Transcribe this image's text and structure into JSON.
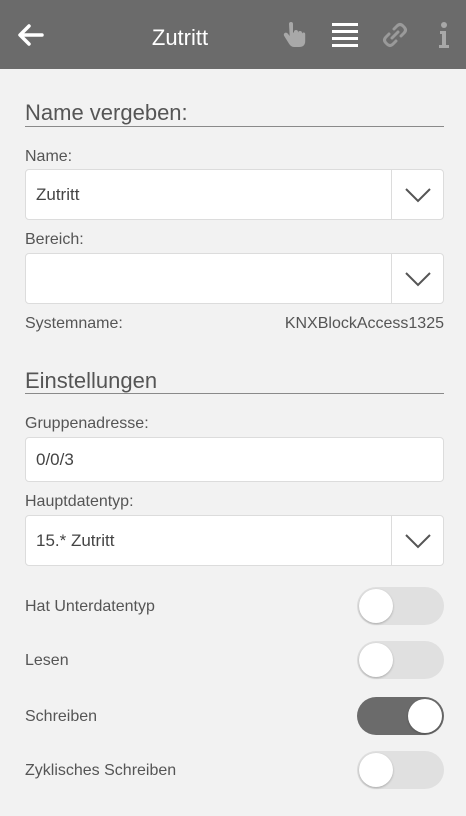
{
  "header": {
    "title": "Zutritt",
    "icons": [
      "back-arrow-icon",
      "hand-icon",
      "list-icon",
      "link-icon",
      "info-icon"
    ]
  },
  "name_section": {
    "heading": "Name vergeben:",
    "name_label": "Name:",
    "name_value": "Zutritt",
    "bereich_label": "Bereich:",
    "bereich_value": "",
    "systemname_label": "Systemname:",
    "systemname_value": "KNXBlockAccess1325"
  },
  "settings_section": {
    "heading": "Einstellungen",
    "gruppenadresse_label": "Gruppenadresse:",
    "gruppenadresse_value": "0/0/3",
    "hauptdatentyp_label": "Hauptdatentyp:",
    "hauptdatentyp_value": "15.* Zutritt",
    "toggles": [
      {
        "label": "Hat Unterdatentyp",
        "on": false
      },
      {
        "label": "Lesen",
        "on": false
      },
      {
        "label": "Schreiben",
        "on": true
      },
      {
        "label": "Zyklisches Schreiben",
        "on": false
      }
    ]
  },
  "colors": {
    "topbar": "#6b6b6b",
    "background": "#f2f2f2",
    "toggle_on": "#6b6b6b",
    "toggle_off": "#e0e0e0"
  }
}
